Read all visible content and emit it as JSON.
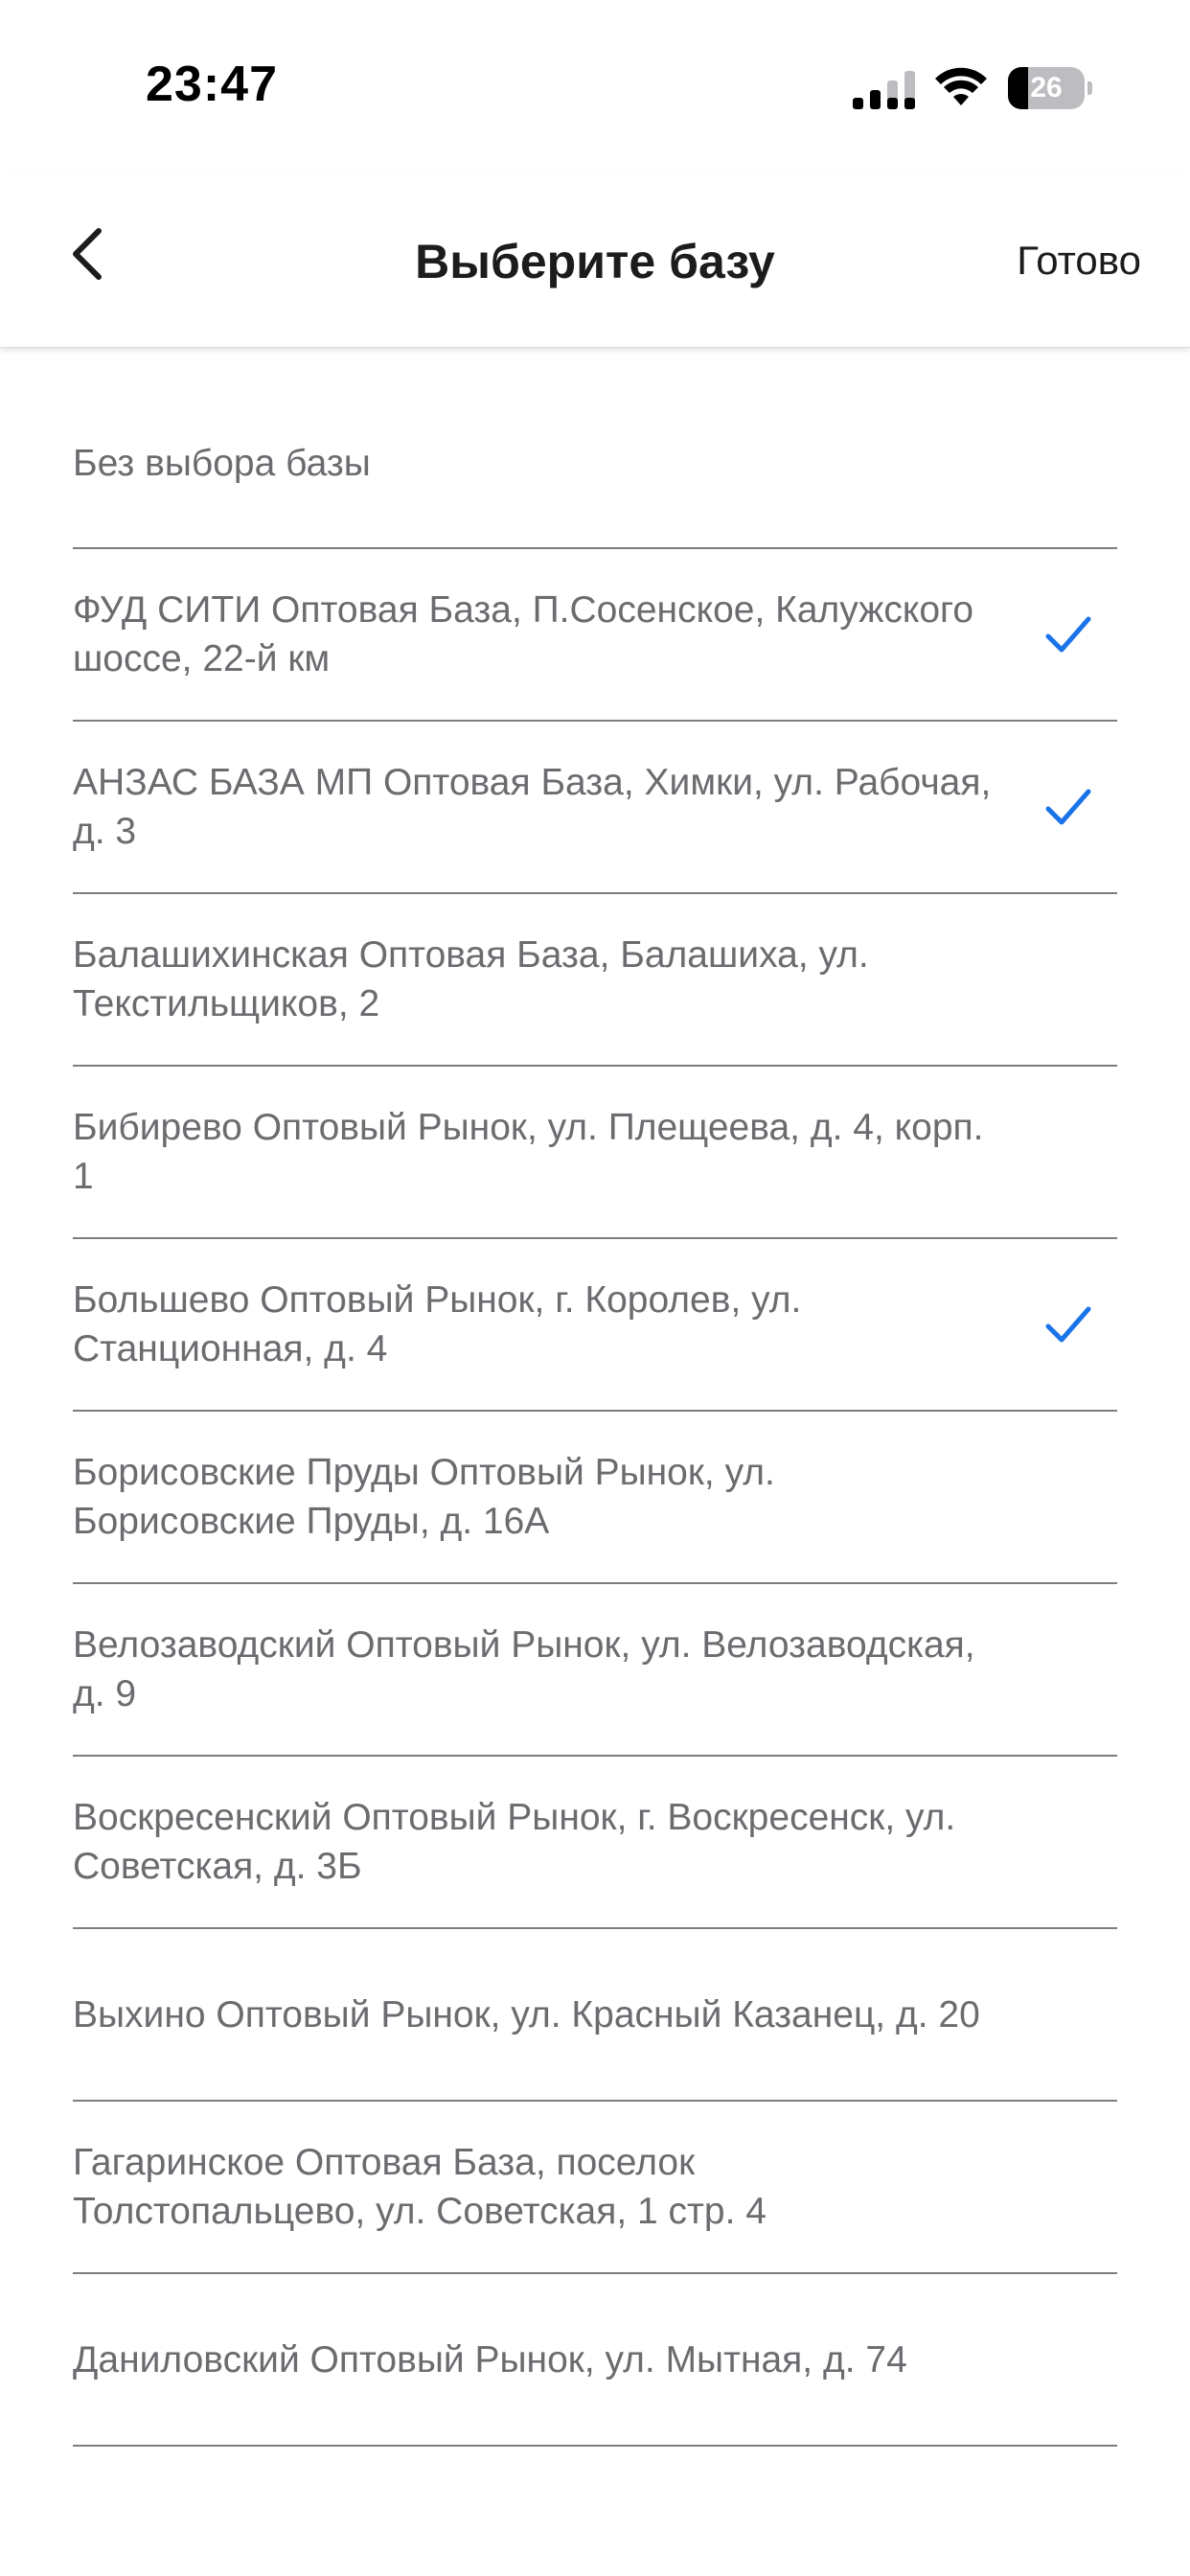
{
  "status_bar": {
    "time": "23:47",
    "battery": "26",
    "icons": [
      "signal-icon",
      "wifi-icon",
      "battery-icon"
    ]
  },
  "nav": {
    "title": "Выберите базу",
    "done_label": "Готово",
    "back_icon": "chevron-left-icon"
  },
  "colors": {
    "accent": "#1a73e8",
    "text": "#6b6b70",
    "divider": "#7d7d80"
  },
  "list": {
    "none_option": "Без выбора базы",
    "items": [
      {
        "label": "ФУД СИТИ Оптовая База, П.Сосенское, Калужского шоссе, 22-й км",
        "selected": true
      },
      {
        "label": "АНЗАС БАЗА МП Оптовая База, Химки, ул. Рабочая, д. 3",
        "selected": true
      },
      {
        "label": "Балашихинская Оптовая База, Балашиха, ул. Текстильщиков, 2",
        "selected": false
      },
      {
        "label": "Бибирево Оптовый Рынок, ул. Плещеева, д. 4, корп. 1",
        "selected": false
      },
      {
        "label": "Большево Оптовый Рынок, г. Королев, ул. Станционная, д. 4",
        "selected": true
      },
      {
        "label": "Борисовские Пруды Оптовый Рынок, ул. Борисовские Пруды, д. 16А",
        "selected": false
      },
      {
        "label": "Велозаводский Оптовый Рынок, ул. Велозаводская, д. 9",
        "selected": false
      },
      {
        "label": "Воскресенский Оптовый Рынок, г. Воскресенск, ул. Советская, д. 3Б",
        "selected": false
      },
      {
        "label": "Выхино Оптовый Рынок, ул. Красный Казанец, д. 20",
        "selected": false
      },
      {
        "label": "Гагаринское Оптовая База, поселок Толстопальцево, ул. Советская, 1 стр. 4",
        "selected": false
      },
      {
        "label": "Даниловский Оптовый Рынок, ул. Мытная, д. 74",
        "selected": false
      }
    ]
  }
}
